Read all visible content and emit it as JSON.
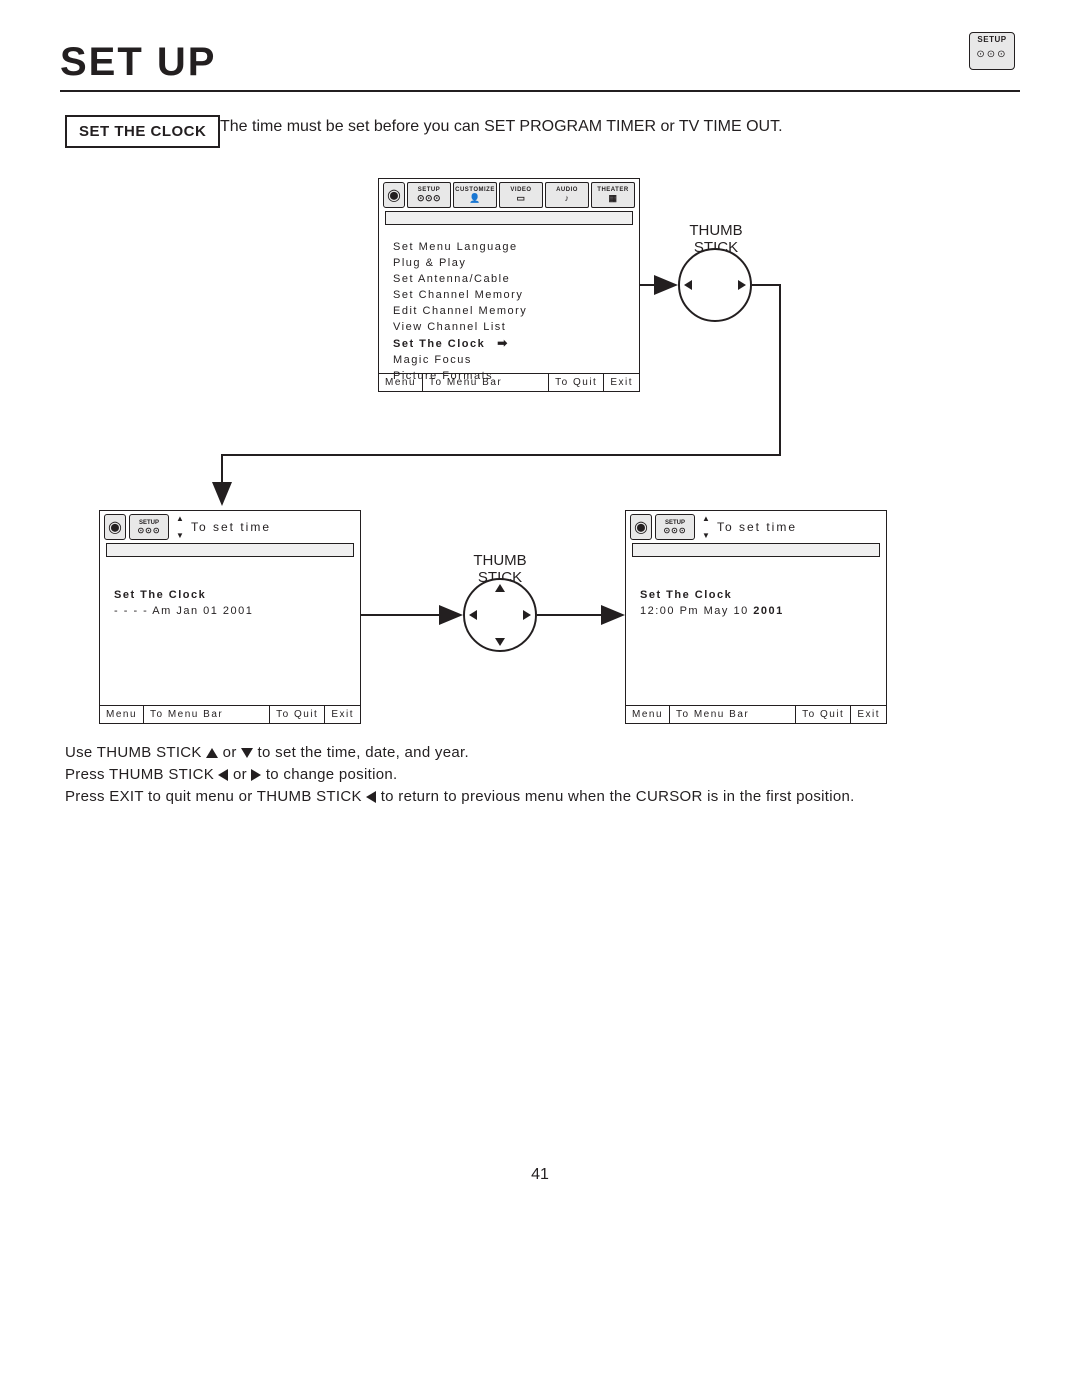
{
  "page": {
    "title": "SET UP",
    "number": "41"
  },
  "corner_icon": {
    "label": "SETUP"
  },
  "section": {
    "label": "SET THE CLOCK",
    "desc": "The time must be set before you can  SET PROGRAM TIMER or TV TIME OUT."
  },
  "menu_panel": {
    "tabs": [
      "SETUP",
      "CUSTOMIZE",
      "VIDEO",
      "AUDIO",
      "THEATER"
    ],
    "items": [
      "Set Menu Language",
      "Plug & Play",
      "Set Antenna/Cable",
      "Set Channel Memory",
      "Edit Channel Memory",
      "View Channel List"
    ],
    "selected": "Set The Clock",
    "items_after": [
      "Magic Focus",
      "Picture Formats"
    ],
    "footer": {
      "menu": "Menu",
      "bar": "To Menu Bar",
      "quit": "To Quit",
      "exit": "Exit"
    }
  },
  "sub_panel_bl": {
    "setup_label": "SETUP",
    "header": "To set time",
    "title": "Set The Clock",
    "value": "- -  - - Am Jan 01 2001",
    "footer": {
      "menu": "Menu",
      "bar": "To Menu Bar",
      "quit": "To Quit",
      "exit": "Exit"
    }
  },
  "sub_panel_br": {
    "setup_label": "SETUP",
    "header": "To set time",
    "title": "Set The Clock",
    "value_pre": "12:00 Pm May 10 ",
    "value_bold": "2001",
    "footer": {
      "menu": "Menu",
      "bar": "To Menu Bar",
      "quit": "To Quit",
      "exit": "Exit"
    }
  },
  "thumbstick_label": "THUMB\nSTICK",
  "instructions": {
    "line1a": "Use THUMB STICK ",
    "line1b": " or ",
    "line1c": " to set the time, date, and year.",
    "line2a": "Press THUMB STICK ",
    "line2b": " or ",
    "line2c": " to change position.",
    "line3a": "Press EXIT to quit menu or THUMB STICK ",
    "line3b": " to return to previous menu when the CURSOR is in the first position."
  }
}
